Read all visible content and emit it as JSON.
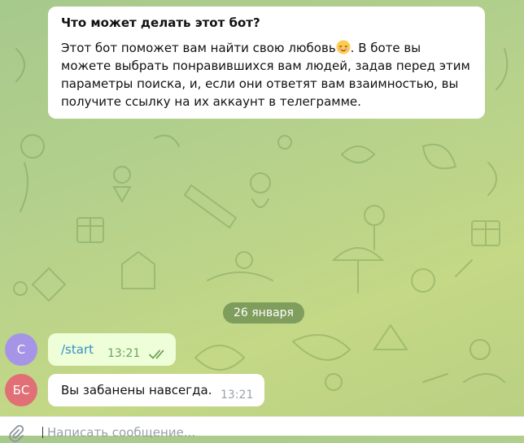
{
  "bot_info": {
    "title": "Что может делать этот бот?",
    "desc_before_emoji": "Этот бот поможет вам найти свою любовь",
    "emoji": "relieved-face-emoji",
    "desc_after_emoji": ". В боте вы можете выбрать понравившихся вам людей, задав перед этим параметры поиска, и, если они ответят вам взаимностью, вы получите ссылку на их аккаунт в телеграмме."
  },
  "date_separator": "26 января",
  "messages": [
    {
      "direction": "outgoing",
      "avatar_initials": "С",
      "avatar_color": "#a695e7",
      "text": "/start",
      "time": "13:21",
      "status": "read"
    },
    {
      "direction": "incoming",
      "avatar_initials": "БС",
      "avatar_color": "#e17076",
      "text": "Вы забанены навсегда.",
      "time": "13:21"
    }
  ],
  "composer": {
    "placeholder": "Написать сообщение...",
    "attach_icon": "paperclip-icon"
  },
  "colors": {
    "outgoing_bubble": "#eefed8",
    "command_link": "#3390c7",
    "read_checks": "#6fa25c"
  }
}
